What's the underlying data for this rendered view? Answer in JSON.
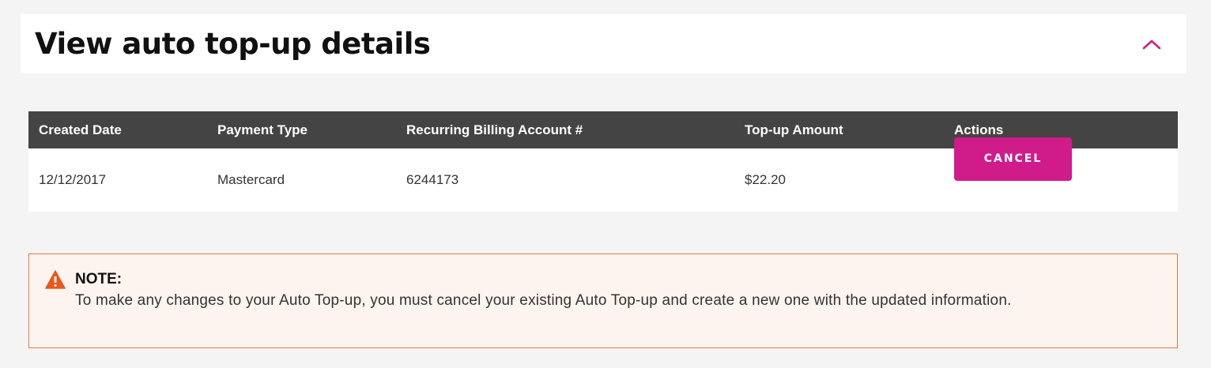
{
  "header": {
    "title": "View auto top-up details",
    "toggle_icon": "chevron-up-icon",
    "accent_color": "#d01c8b"
  },
  "table": {
    "columns": [
      "Created Date",
      "Payment Type",
      "Recurring Billing Account #",
      "Top-up Amount",
      "Actions"
    ],
    "rows": [
      {
        "created_date": "12/12/2017",
        "payment_type": "Mastercard",
        "account_number": "6244173",
        "amount": "$22.20",
        "action_label": "CANCEL"
      }
    ]
  },
  "note": {
    "icon": "warning-icon",
    "title": "NOTE:",
    "text": "To make any changes to your Auto Top-up, you must cancel your existing Auto Top-up and create a new one with the updated information."
  }
}
